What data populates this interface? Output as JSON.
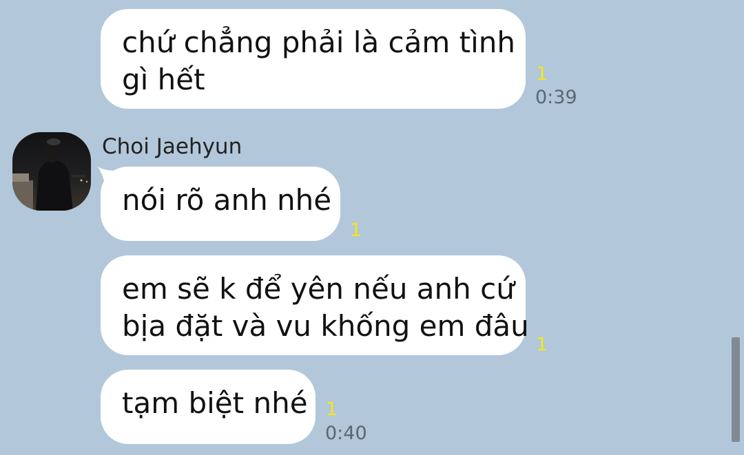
{
  "messages": [
    {
      "lines": [
        "chứ chẳng phải là cảm tình",
        "gì hết"
      ],
      "unread": "1",
      "time": "0:39"
    },
    {
      "sender": "Choi Jaehyun",
      "lines": [
        "nói rõ anh nhé"
      ],
      "unread": "1"
    },
    {
      "lines": [
        "em sẽ k để yên nếu anh cứ",
        "bịa đặt và vu khống em đâu"
      ],
      "unread": "1"
    },
    {
      "lines": [
        "tạm biệt nhé"
      ],
      "unread": "1",
      "time": "0:40"
    }
  ],
  "colors": {
    "background": "#b2c7da",
    "bubble": "#ffffff",
    "unread": "#f5e61a",
    "time": "#5b6670"
  }
}
